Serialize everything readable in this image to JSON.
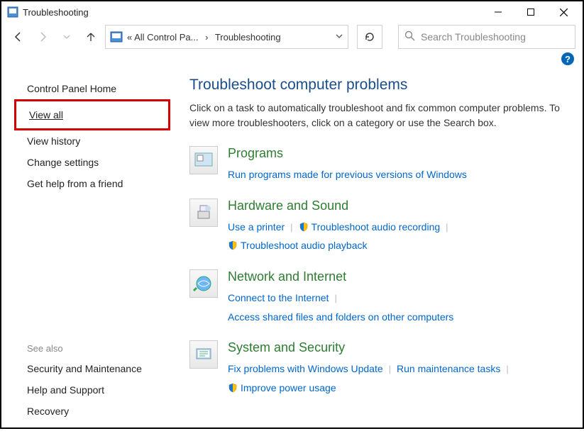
{
  "window": {
    "title": "Troubleshooting"
  },
  "address": {
    "text_left": "« All Control Pa...",
    "chevron": "›",
    "text_right": "Troubleshooting"
  },
  "search": {
    "placeholder": "Search Troubleshooting"
  },
  "sidebar": {
    "items": [
      {
        "label": "Control Panel Home"
      },
      {
        "label": "View all"
      },
      {
        "label": "View history"
      },
      {
        "label": "Change settings"
      },
      {
        "label": "Get help from a friend"
      }
    ],
    "see_also_header": "See also",
    "see_also": [
      {
        "label": "Security and Maintenance"
      },
      {
        "label": "Help and Support"
      },
      {
        "label": "Recovery"
      }
    ]
  },
  "content": {
    "heading": "Troubleshoot computer problems",
    "description": "Click on a task to automatically troubleshoot and fix common computer problems. To view more troubleshooters, click on a category or use the Search box.",
    "categories": [
      {
        "title": "Programs",
        "links": [
          {
            "label": "Run programs made for previous versions of Windows",
            "shield": false
          }
        ]
      },
      {
        "title": "Hardware and Sound",
        "links": [
          {
            "label": "Use a printer",
            "shield": false
          },
          {
            "label": "Troubleshoot audio recording",
            "shield": true
          },
          {
            "label": "Troubleshoot audio playback",
            "shield": true
          }
        ]
      },
      {
        "title": "Network and Internet",
        "links": [
          {
            "label": "Connect to the Internet",
            "shield": false
          },
          {
            "label": "Access shared files and folders on other computers",
            "shield": false
          }
        ]
      },
      {
        "title": "System and Security",
        "links": [
          {
            "label": "Fix problems with Windows Update",
            "shield": false
          },
          {
            "label": "Run maintenance tasks",
            "shield": false
          },
          {
            "label": "Improve power usage",
            "shield": true
          }
        ]
      }
    ]
  }
}
